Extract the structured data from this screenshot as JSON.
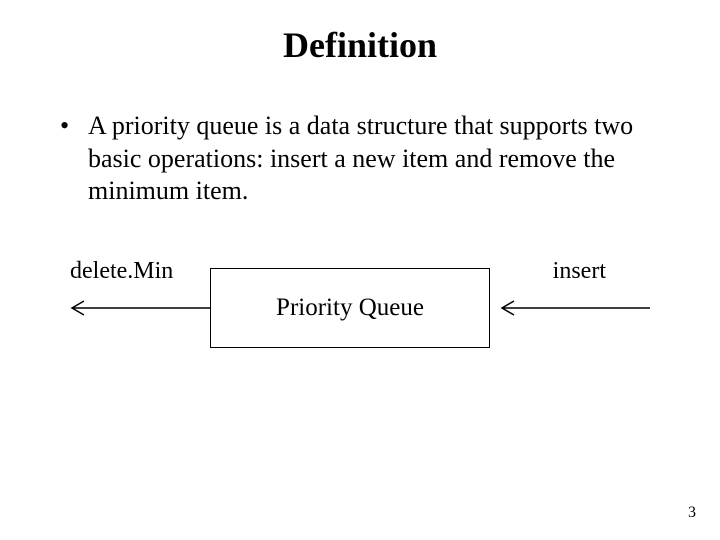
{
  "title": "Definition",
  "bullet": {
    "marker": "•",
    "text": "A priority queue is a data structure that supports two basic operations: insert a new item and remove the minimum item."
  },
  "diagram": {
    "left_label": "delete.Min",
    "right_label": "insert",
    "box_label": "Priority Queue"
  },
  "page_number": "3"
}
